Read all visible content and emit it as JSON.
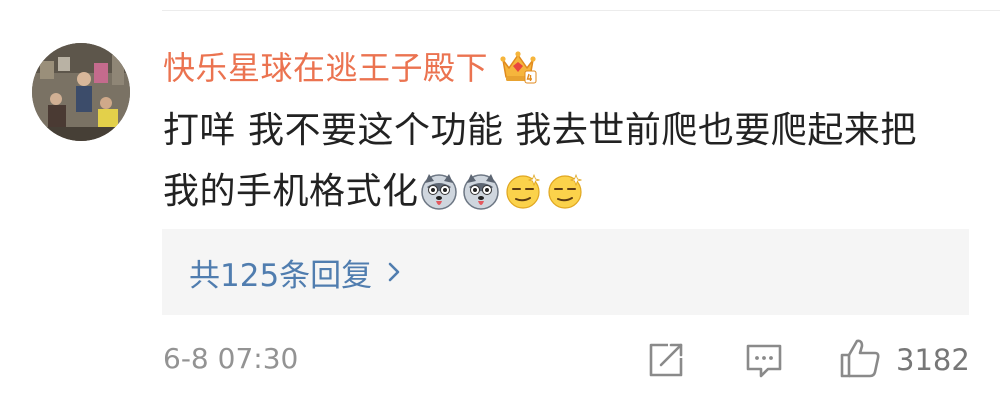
{
  "comment": {
    "username": "快乐星球在逃王子殿下",
    "text_lines": [
      "打咩 我不要这个功能 我去世前爬也要爬起来把",
      "我的手机格式化"
    ],
    "emojis": [
      "husky-face-icon",
      "husky-face-icon",
      "smirk-face-icon",
      "smirk-face-icon"
    ],
    "replies_label": "共125条回复",
    "timestamp": "6-8 07:30",
    "like_count": "3182"
  },
  "colors": {
    "username": "#eb7350",
    "link": "#507daf",
    "text": "#222222",
    "meta": "#939393",
    "reply_bg": "#f5f5f5"
  },
  "icons": {
    "badge": "crown-badge-icon",
    "repost": "repost-icon",
    "comment": "comment-icon",
    "like": "thumbs-up-icon",
    "chevron": "chevron-right-icon"
  }
}
